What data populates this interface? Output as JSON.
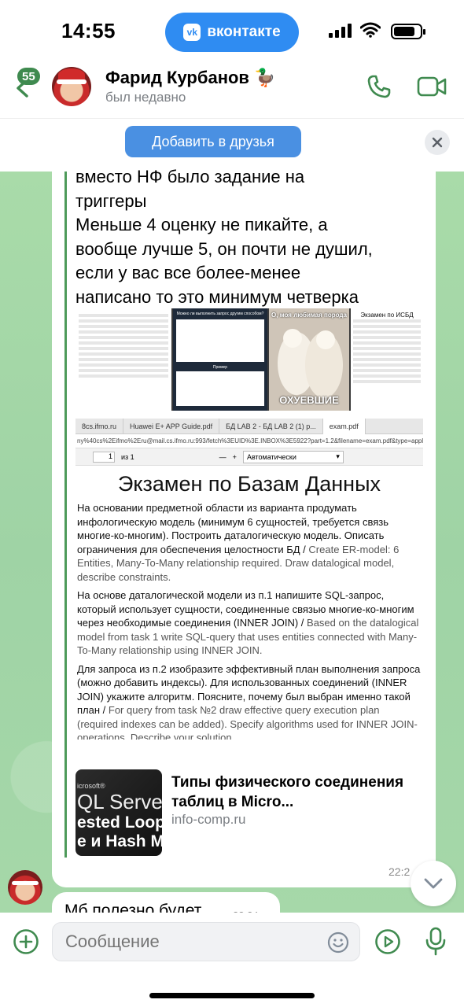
{
  "status_bar": {
    "time": "14:55",
    "app_pill": "вконтакте",
    "app_logo": "vk",
    "icons": [
      "signal-icon",
      "wifi-icon",
      "battery-icon"
    ]
  },
  "header": {
    "unread_count": "55",
    "contact_name": "Фарид Курбанов",
    "contact_emoji": "🦆",
    "contact_status": "был недавно"
  },
  "friend_bar": {
    "add_friend_label": "Добавить в друзья"
  },
  "message": {
    "text_lines": [
      "вместо НФ было задание на",
      "триггеры",
      "Меньше 4 оценку не пикайте, а",
      "вообще лучше 5, он почти не душил,",
      "если у вас все более-менее",
      "написано то это минимум четверка"
    ],
    "meme_top": "О, моя любимая порода",
    "meme_bottom": "ОХУЕВШИЕ",
    "tile_b_title": "Можно ли выполнить запрос другим способом?",
    "tile_b_label": "Пример",
    "tile_d_title": "Экзамен по ИСБД",
    "browser": {
      "tabs": [
        "8cs.ifmo.ru",
        "Huawei E+ APP Guide.pdf",
        "БД LAB 2 - БД LAB 2 (1) p...",
        "exam.pdf"
      ],
      "url": "ny%40cs%2Eifmo%2Eru@mail.cs.ifmo.ru:993/fetch%3EUID%3E.INBOX%3E5922?part=1.2&filename=exam.pdf&type=application/pdf",
      "page_number": "1",
      "page_total": "из 1",
      "zoom": "Автоматически"
    },
    "pdf": {
      "title": "Экзамен по Базам Данных",
      "p1_ru": "На основании предметной области из варианта продумать инфологическую модель (минимум 6 сущностей, требуется связь многие-ко-многим). Построить даталогическую модель. Описать ограничения для обеспечения целостности БД /",
      "p1_en": "Create ER-model: 6 Entities, Many-To-Many relationship required. Draw datalogical model, describe constraints.",
      "p2_ru": "На основе даталогической модели из п.1 напишите SQL-запрос, который использует сущности, соединенные связью многие-ко-многим через необходимые соединения (INNER JOIN) /",
      "p2_en": "Based on the datalogical model from task 1 write SQL-query that uses entities connected with Many-To-Many relationship using INNER JOIN.",
      "p3_ru": "Для запроса из п.2 изобразите эффективный план выполнения запроса (можно добавить индексы). Для использованных соединений (INNER JOIN) укажите алгоритм. Поясните, почему был выбран именно такой план /",
      "p3_en": "For query from task №2 draw effective query execution plan (required indexes can be added). Specify algorithms used for INNER JOIN-operations. Describe your solution."
    },
    "link": {
      "title": "Типы физического соединения таблиц в Micro...",
      "domain": "info-comp.ru",
      "thumb_lines": [
        "icrosoft®",
        "QL Serve",
        "ested Loop",
        "e и Hash M"
      ]
    },
    "time": "22:2"
  },
  "message2": {
    "text": "Мб полезно будет",
    "time": "22:24"
  },
  "composer": {
    "placeholder": "Сообщение"
  },
  "colors": {
    "accent_green": "#3f8a4f",
    "button_blue": "#4a90e2",
    "vk_blue": "#2f8cf2",
    "wallpaper": "#9fd3a5"
  }
}
